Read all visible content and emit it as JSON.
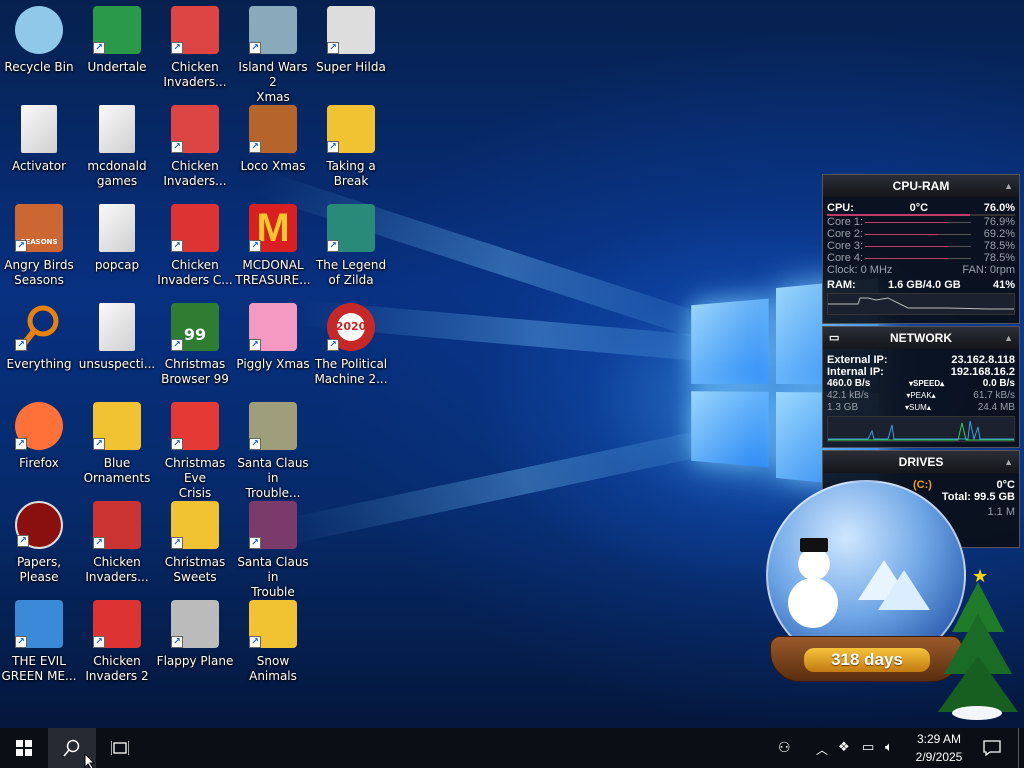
{
  "desktop": {
    "icons": [
      {
        "label": "Recycle Bin",
        "icon": "recycle-bin-icon",
        "color": "#8fc8e8",
        "shortcut": false
      },
      {
        "label": "Undertale",
        "icon": "undertale-icon",
        "color": "#2a9a4a",
        "shortcut": true
      },
      {
        "label": "Chicken\nInvaders...",
        "icon": "chicken-icon",
        "color": "#d44",
        "shortcut": true
      },
      {
        "label": "Island Wars 2\nXmas",
        "icon": "island-wars-icon",
        "color": "#8ab",
        "shortcut": true
      },
      {
        "label": "Super Hilda",
        "icon": "super-hilda-icon",
        "color": "#ddd",
        "shortcut": true
      },
      {
        "label": "Activator",
        "icon": "folder-icon",
        "color": "#eee",
        "shortcut": false
      },
      {
        "label": "mcdonald\ngames",
        "icon": "folder-icon",
        "color": "#eee",
        "shortcut": false
      },
      {
        "label": "Chicken\nInvaders...",
        "icon": "chicken-icon",
        "color": "#d44",
        "shortcut": true
      },
      {
        "label": "Loco Xmas",
        "icon": "loco-xmas-icon",
        "color": "#b5652a",
        "shortcut": true
      },
      {
        "label": "Taking a\nBreak",
        "icon": "taking-break-icon",
        "color": "#f1c232",
        "shortcut": true
      },
      {
        "label": "Angry Birds\nSeasons",
        "icon": "angry-birds-icon",
        "color": "#c63",
        "shortcut": true
      },
      {
        "label": "popcap",
        "icon": "folder-icon",
        "color": "#eee",
        "shortcut": false
      },
      {
        "label": "Chicken\nInvaders C...",
        "icon": "chicken-icon",
        "color": "#d33",
        "shortcut": true
      },
      {
        "label": "MCDONAL\nTREASURE...",
        "icon": "mcdonalds-icon",
        "color": "#d91f1f",
        "shortcut": true
      },
      {
        "label": "The Legend\nof Zilda",
        "icon": "zilda-icon",
        "color": "#2a8a7a",
        "shortcut": true
      },
      {
        "label": "Everything",
        "icon": "search-magnifier-icon",
        "color": "#e8820c",
        "shortcut": true
      },
      {
        "label": "unsuspecti...",
        "icon": "folder-icon",
        "color": "#eee",
        "shortcut": false
      },
      {
        "label": "Christmas\nBrowser 99",
        "icon": "xmas-tree-icon",
        "color": "#2e7d32",
        "shortcut": true
      },
      {
        "label": "Piggly Xmas",
        "icon": "piggly-icon",
        "color": "#f49ac2",
        "shortcut": true
      },
      {
        "label": "The Political\nMachine 2...",
        "icon": "political-machine-icon",
        "color": "#c62828",
        "shortcut": true
      },
      {
        "label": "Firefox",
        "icon": "firefox-icon",
        "color": "#ff7139",
        "shortcut": true
      },
      {
        "label": "Blue\nOrnaments",
        "icon": "blue-ornaments-icon",
        "color": "#f1c232",
        "shortcut": true
      },
      {
        "label": "Christmas Eve\nCrisis",
        "icon": "santa-icon",
        "color": "#e53935",
        "shortcut": true
      },
      {
        "label": "Santa Claus in\nTrouble... A...",
        "icon": "santa-claus-icon",
        "color": "#9e9e7a",
        "shortcut": true
      },
      {
        "label": "Papers, Please",
        "icon": "papers-please-icon",
        "color": "#8a1010",
        "shortcut": true
      },
      {
        "label": "Chicken\nInvaders...",
        "icon": "chicken-icon",
        "color": "#c33",
        "shortcut": true
      },
      {
        "label": "Christmas\nSweets",
        "icon": "xmas-sweets-icon",
        "color": "#f1c232",
        "shortcut": true
      },
      {
        "label": "Santa Claus in\nTrouble",
        "icon": "santa-claus-icon",
        "color": "#7a3a6a",
        "shortcut": true
      },
      {
        "label": "THE EVIL\nGREEN ME...",
        "icon": "messenger-icon",
        "color": "#3a8ad8",
        "shortcut": true
      },
      {
        "label": "Chicken\nInvaders 2",
        "icon": "chicken-icon",
        "color": "#d33",
        "shortcut": true
      },
      {
        "label": "Flappy Plane",
        "icon": "flappy-plane-icon",
        "color": "#bbb",
        "shortcut": true
      },
      {
        "label": "Snow\nAnimals",
        "icon": "snow-animals-icon",
        "color": "#f1c232",
        "shortcut": true
      }
    ],
    "icon_text": {
      "angry_birds": "SEASONS",
      "christmas_browser": "99",
      "political": "2020"
    }
  },
  "gadgets": {
    "cpu_ram": {
      "title": "CPU-RAM",
      "cpu_label": "CPU:",
      "cpu_temp": "0°C",
      "cpu_pct": "76.0%",
      "cores": [
        {
          "label": "Core 1:",
          "pct": "76.9%",
          "value": 0.769
        },
        {
          "label": "Core 2:",
          "pct": "69.2%",
          "value": 0.692
        },
        {
          "label": "Core 3:",
          "pct": "78.5%",
          "value": 0.785
        },
        {
          "label": "Core 4:",
          "pct": "78.5%",
          "value": 0.785
        }
      ],
      "clock": "Clock: 0 MHz",
      "fan": "FAN: 0rpm",
      "ram_label": "RAM:",
      "ram_used": "1.6 GB/4.0 GB",
      "ram_pct": "41%"
    },
    "network": {
      "title": "NETWORK",
      "external_label": "External IP:",
      "external_ip": "23.162.8.118",
      "internal_label": "Internal IP:",
      "internal_ip": "192.168.16.2",
      "down_speed": "460.0 B/s",
      "speed_label": "SPEED",
      "up_speed": "0.0 B/s",
      "down_peak": "42.1 kB/s",
      "peak_label": "PEAK",
      "up_peak": "61.7 kB/s",
      "down_sum": "1.3 GB",
      "sum_label": "SUM",
      "up_sum": "24.4 MB"
    },
    "drives": {
      "title": "DRIVES",
      "drive": "(C:)",
      "temp": "0°C",
      "total": "Total: 99.5 GB",
      "activity": "1.1 M"
    }
  },
  "snowglobe": {
    "countdown": "318 days"
  },
  "taskbar": {
    "time": "3:29 AM",
    "date": "2/9/2025",
    "start_icon": "windows-start-icon",
    "search_icon": "search-icon",
    "taskview_icon": "task-view-icon"
  }
}
